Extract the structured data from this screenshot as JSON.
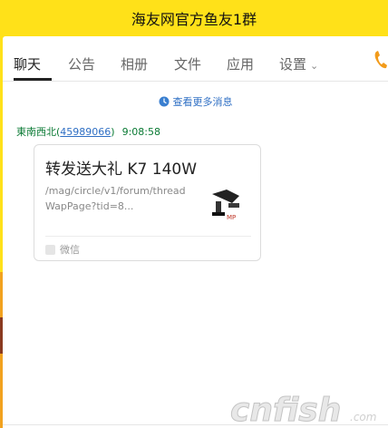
{
  "window": {
    "title": "海友网官方鱼友1群"
  },
  "tabs": [
    {
      "label": "聊天",
      "active": true
    },
    {
      "label": "公告",
      "active": false
    },
    {
      "label": "相册",
      "active": false
    },
    {
      "label": "文件",
      "active": false
    },
    {
      "label": "应用",
      "active": false
    },
    {
      "label": "设置",
      "active": false
    }
  ],
  "icons": {
    "settings_dropdown": "chevron-down-icon",
    "call": "phone-icon",
    "history": "clock-icon",
    "card_source": "wechat-icon"
  },
  "chat": {
    "more_messages": "查看更多消息",
    "message": {
      "sender_name": "東南西北",
      "sender_id_open": "(",
      "sender_id": "45989066",
      "sender_id_close": ")",
      "time": "9:08:58",
      "card": {
        "title": "转发送大礼 K7 140W",
        "url": "/mag/circle/v1/forum/threadWapPage?tid=8...",
        "source": "微信"
      }
    }
  },
  "watermark": {
    "text": "cnfish",
    "suffix": ".com"
  },
  "colors": {
    "titlebar_bg": "#ffe119",
    "accent_link": "#2f6fc4",
    "sender_green": "#0a7a34",
    "phone_orange": "#f29b1b"
  }
}
